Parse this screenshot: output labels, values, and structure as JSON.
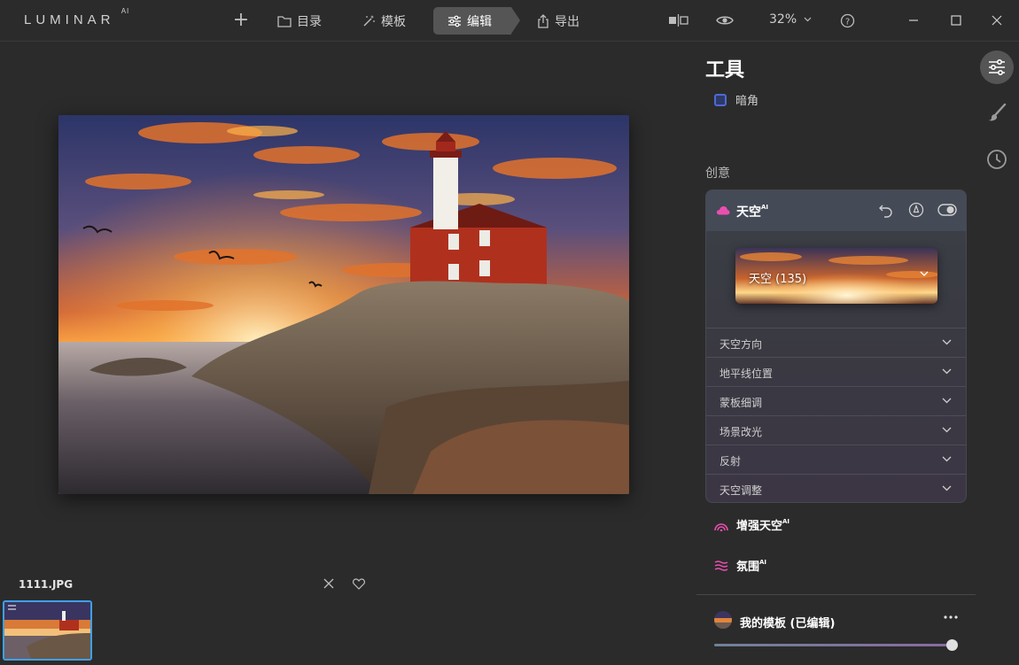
{
  "app": {
    "logo": "LUMINAR",
    "logo_suffix": "AI"
  },
  "nav": {
    "catalog": "目录",
    "templates": "模板",
    "edit": "编辑",
    "export": "导出"
  },
  "view": {
    "zoom": "32%"
  },
  "file": {
    "name": "1111.JPG"
  },
  "panel": {
    "title": "工具",
    "vignette": "暗角",
    "section": "创意",
    "sky": {
      "title": "天空",
      "title_suffix": "AI",
      "selection": "天空 (135)",
      "params": [
        "天空方向",
        "地平线位置",
        "蒙板细调",
        "场景改光",
        "反射",
        "天空调整"
      ]
    },
    "sky_enhancer": {
      "label": "增强天空",
      "suffix": "AI"
    },
    "atmosphere": {
      "label": "氛围",
      "suffix": "AI"
    },
    "preset": {
      "name": "我的模板 (已编辑)",
      "amount": 1.0
    }
  },
  "colors": {
    "accent": "#e94fb0",
    "selection": "#3fa0e8"
  },
  "icons": [
    "plus-icon",
    "folder-icon",
    "magic-wand-icon",
    "sliders-icon",
    "export-icon",
    "compare-icon",
    "eye-icon",
    "help-icon",
    "minimize-icon",
    "maximize-icon",
    "close-icon",
    "cloud-icon",
    "undo-icon",
    "favorite-icon",
    "toggle-icon",
    "chevron-down-icon",
    "heart-icon",
    "brush-icon",
    "history-icon",
    "more-icon"
  ]
}
